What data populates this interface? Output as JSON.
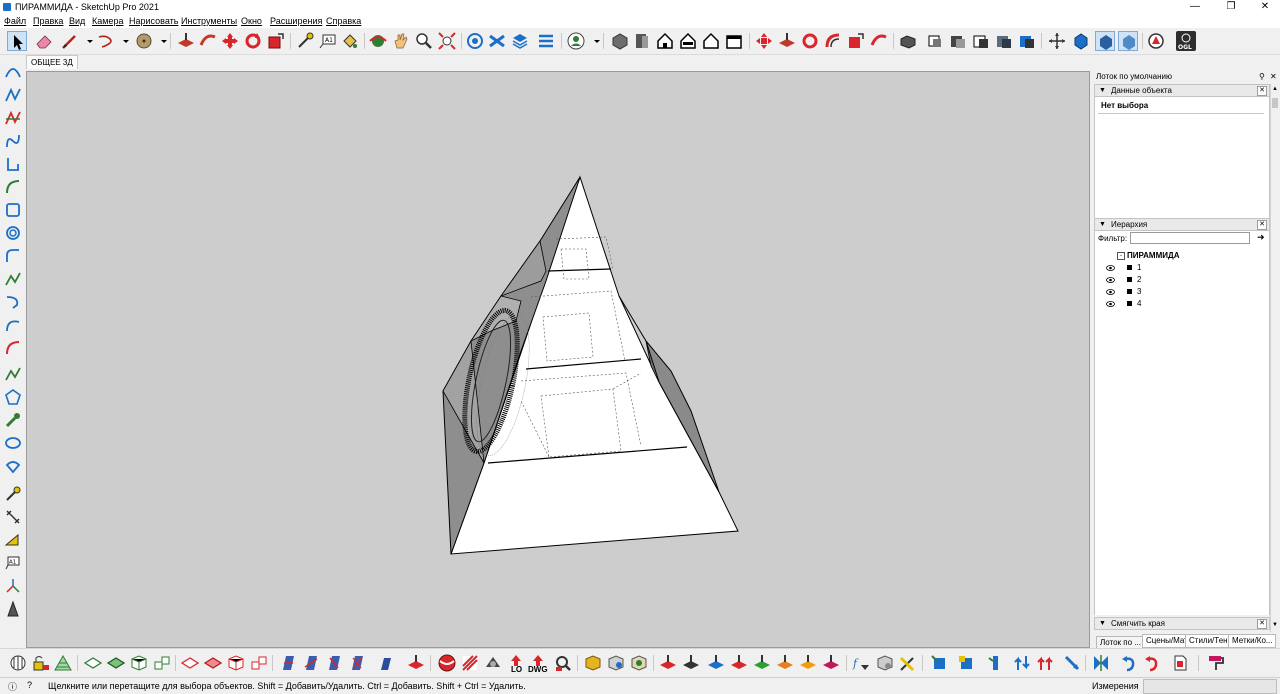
{
  "window": {
    "title": "ПИРАММИДА - SketchUp Pro 2021"
  },
  "menu": [
    "Файл",
    "Правка",
    "Вид",
    "Камера",
    "Нарисовать",
    "Инструменты",
    "Окно",
    "Расширения",
    "Справка"
  ],
  "scene_tab": "ОБЩЕЕ 3Д",
  "tray": {
    "title": "Лоток по умолчанию",
    "entity_info": {
      "title": "Данные объекта",
      "status": "Нет выбора"
    },
    "outliner": {
      "title": "Иерархия",
      "filter_label": "Фильтр:",
      "filter_value": "",
      "root": "ПИРАММИДА",
      "items": [
        "1",
        "2",
        "3",
        "4"
      ]
    },
    "soften": {
      "title": "Смягчить края"
    },
    "bottom_tabs": [
      "Лоток по ...",
      "Сцены/Мат",
      "Стили/Тени",
      "Метки/Ко..."
    ]
  },
  "status": {
    "hint": "Щелкните или перетащите для выбора объектов. Shift = Добавить/Удалить. Ctrl = Добавить. Shift + Ctrl = Удалить.",
    "measure_label": "Измерения",
    "measure_value": ""
  },
  "labels": {
    "lo": "LO",
    "dwg": "DWG",
    "ogl": "OGL"
  },
  "colors": {
    "viewport_bg": "#cdcdcd",
    "accent_blue": "#1c6fc7",
    "accent_red": "#d9262c"
  }
}
